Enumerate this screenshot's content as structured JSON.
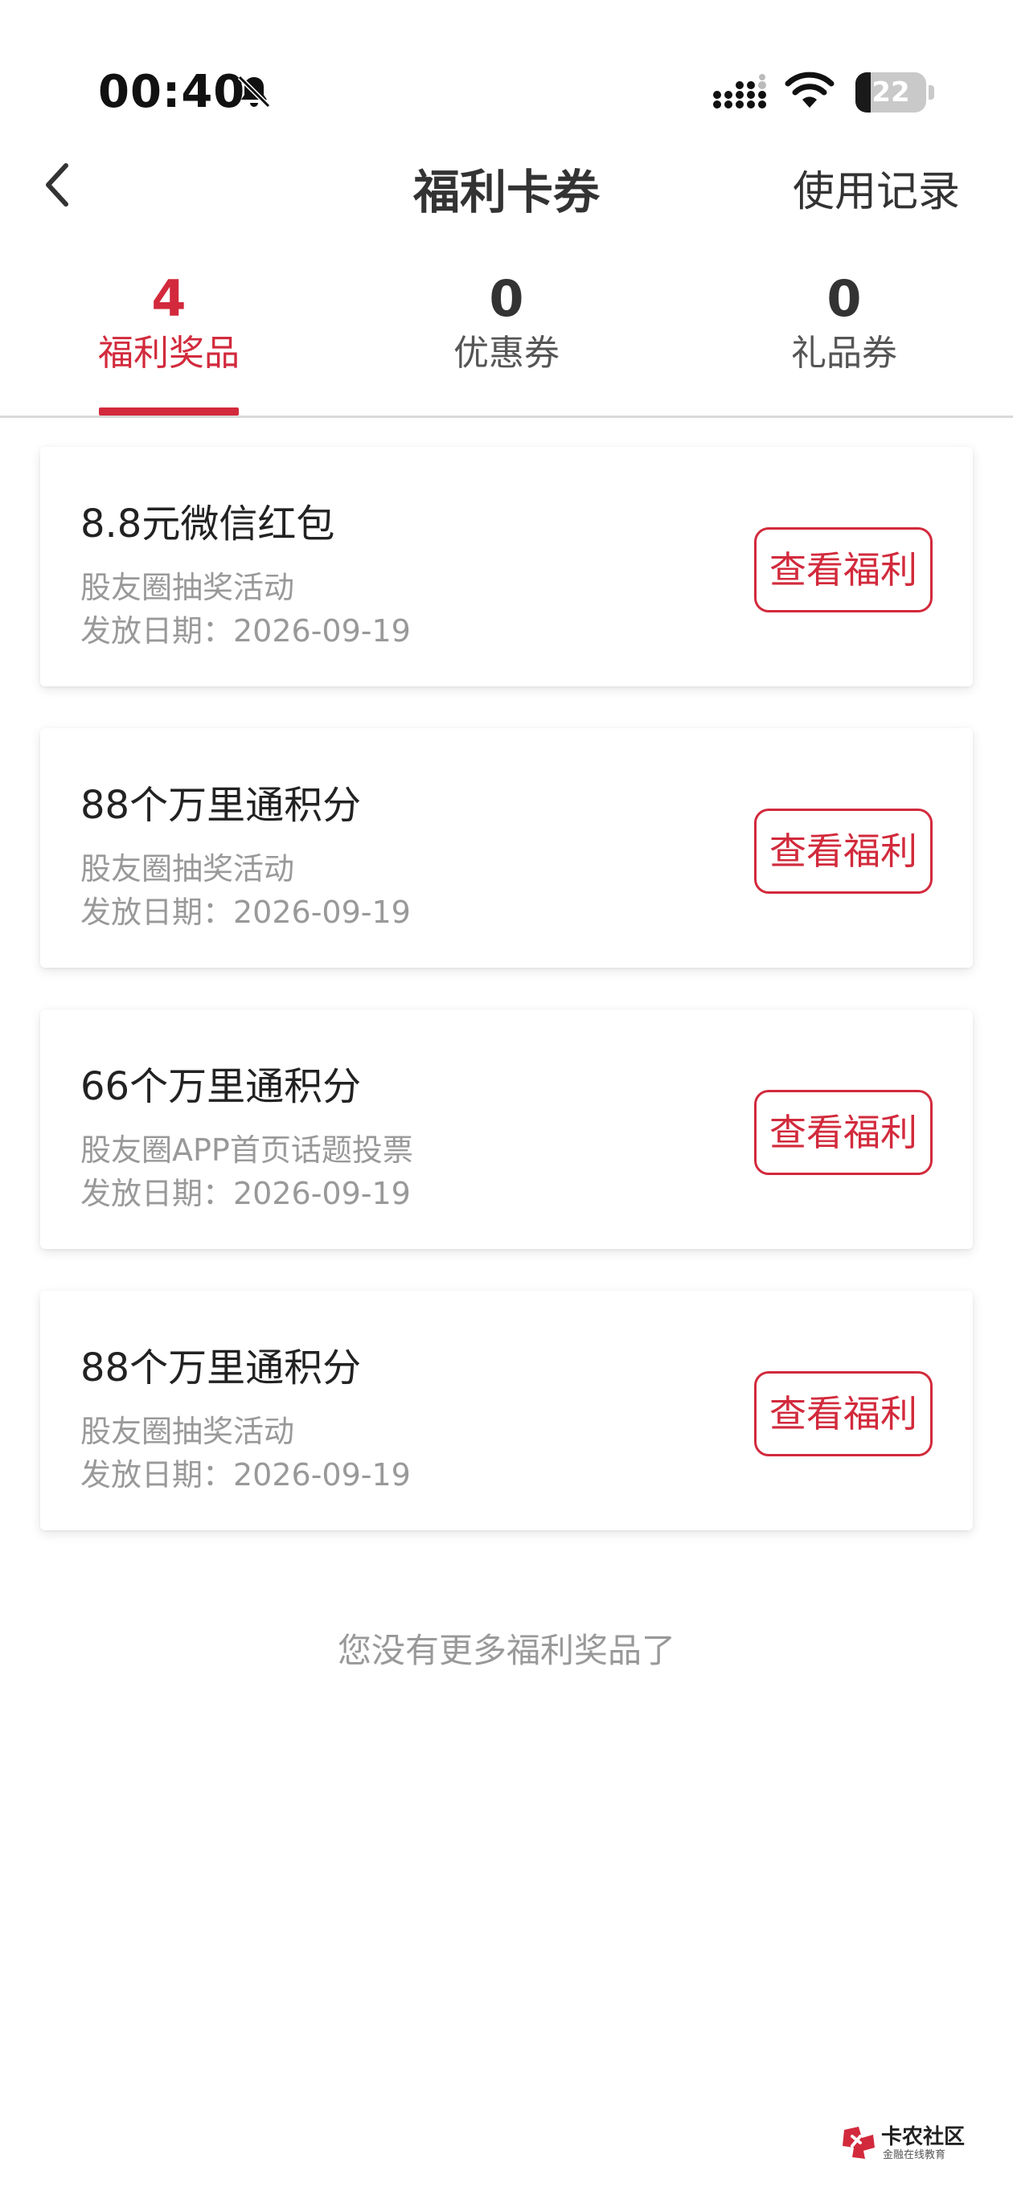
{
  "status_bar": {
    "time": "00:40",
    "battery_level": "22",
    "battery_fraction": 0.22
  },
  "nav": {
    "title": "福利卡券",
    "right_action": "使用记录"
  },
  "tabs": [
    {
      "count": "4",
      "label": "福利奖品",
      "active": true
    },
    {
      "count": "0",
      "label": "优惠券",
      "active": false
    },
    {
      "count": "0",
      "label": "礼品券",
      "active": false
    }
  ],
  "cards": [
    {
      "title": "8.8元微信红包",
      "source": "股友圈抽奖活动",
      "date": "发放日期：2026-09-19",
      "button": "查看福利"
    },
    {
      "title": "88个万里通积分",
      "source": "股友圈抽奖活动",
      "date": "发放日期：2026-09-19",
      "button": "查看福利"
    },
    {
      "title": "66个万里通积分",
      "source": "股友圈APP首页话题投票",
      "date": "发放日期：2026-09-19",
      "button": "查看福利"
    },
    {
      "title": "88个万里通积分",
      "source": "股友圈抽奖活动",
      "date": "发放日期：2026-09-19",
      "button": "查看福利"
    }
  ],
  "end_note": "您没有更多福利奖品了",
  "watermark": {
    "name": "卡农社区",
    "tagline": "金融在线教育"
  },
  "colors": {
    "accent": "#d22a3c",
    "text_primary": "#333333",
    "text_secondary": "#999999"
  }
}
